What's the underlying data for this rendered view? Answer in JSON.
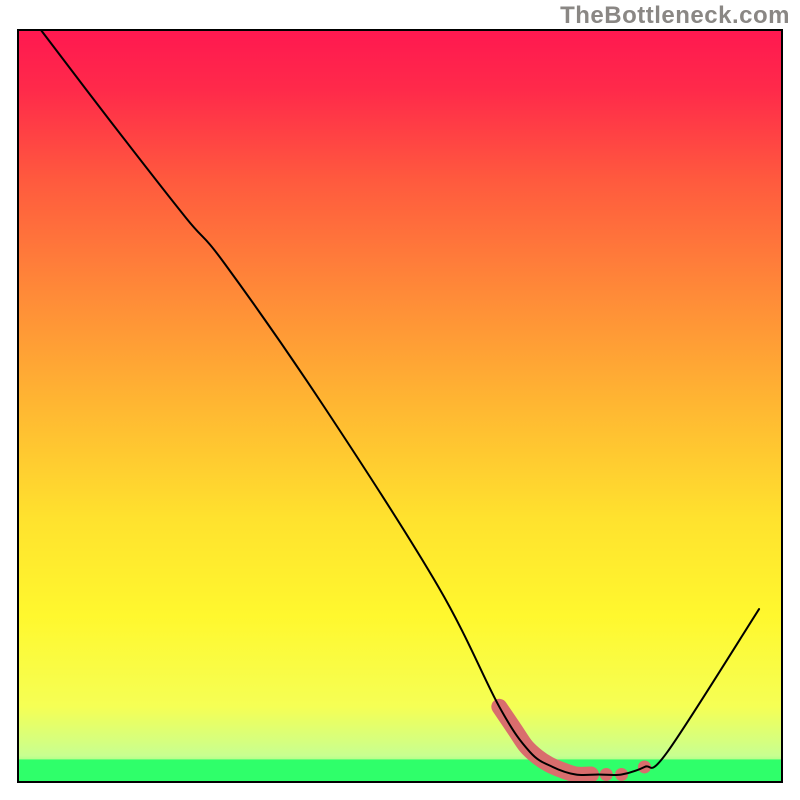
{
  "watermark": "TheBottleneck.com",
  "chart_data": {
    "type": "line",
    "title": "",
    "xlabel": "",
    "ylabel": "",
    "xlim": [
      0,
      100
    ],
    "ylim": [
      0,
      100
    ],
    "grid": false,
    "legend": false,
    "annotations": [],
    "background_gradient": {
      "stops": [
        {
          "offset": 0.0,
          "color": "#ff1850"
        },
        {
          "offset": 0.08,
          "color": "#ff2a4a"
        },
        {
          "offset": 0.2,
          "color": "#ff5a3e"
        },
        {
          "offset": 0.35,
          "color": "#ff8a38"
        },
        {
          "offset": 0.5,
          "color": "#ffb732"
        },
        {
          "offset": 0.65,
          "color": "#ffe22e"
        },
        {
          "offset": 0.78,
          "color": "#fff82e"
        },
        {
          "offset": 0.9,
          "color": "#f5ff55"
        },
        {
          "offset": 0.965,
          "color": "#c8ff90"
        },
        {
          "offset": 1.0,
          "color": "#2fff6a"
        }
      ]
    },
    "green_band": {
      "y_from": 0,
      "y_to": 3
    },
    "series": [
      {
        "name": "bottleneck-curve",
        "color": "#000000",
        "width": 2,
        "x": [
          3,
          12,
          22,
          27,
          40,
          55,
          63,
          67,
          70,
          73,
          76,
          79,
          82,
          85,
          97
        ],
        "y": [
          100,
          88,
          75,
          69,
          50,
          26,
          10,
          4,
          2,
          1,
          1,
          1,
          2,
          4,
          23
        ]
      }
    ],
    "markers": {
      "name": "highlight-pink",
      "color": "#d96d6d",
      "points_from_curve_x": [
        63,
        65,
        66.5,
        68,
        69.5,
        71,
        73,
        75,
        77,
        79,
        82
      ],
      "style": "blob-then-dots"
    }
  }
}
